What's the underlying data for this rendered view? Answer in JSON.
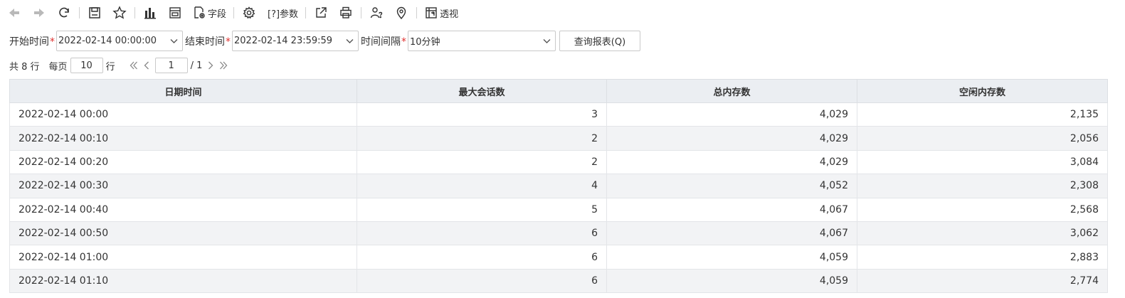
{
  "toolbar": {
    "field_label": "字段",
    "params_label": "[?]参数",
    "pivot_label": "透视"
  },
  "filters": {
    "start_label": "开始时间",
    "start_value": "2022-02-14 00:00:00",
    "end_label": "结束时间",
    "end_value": "2022-02-14 23:59:59",
    "interval_label": "时间间隔",
    "interval_value": "10分钟",
    "required_mark": "*",
    "query_button": "查询报表(Q)"
  },
  "pager": {
    "total_text": "共 8 行",
    "per_page_label": "每页",
    "per_page_value": "10",
    "row_unit": "行",
    "current_page": "1",
    "total_pages": "/ 1"
  },
  "table": {
    "columns": [
      "日期时间",
      "最大会话数",
      "总内存数",
      "空闲内存数"
    ],
    "rows": [
      [
        "2022-02-14  00:00",
        "3",
        "4,029",
        "2,135"
      ],
      [
        "2022-02-14  00:10",
        "2",
        "4,029",
        "2,056"
      ],
      [
        "2022-02-14  00:20",
        "2",
        "4,029",
        "3,084"
      ],
      [
        "2022-02-14  00:30",
        "4",
        "4,052",
        "2,308"
      ],
      [
        "2022-02-14  00:40",
        "5",
        "4,067",
        "2,568"
      ],
      [
        "2022-02-14  00:50",
        "6",
        "4,067",
        "3,062"
      ],
      [
        "2022-02-14  01:00",
        "6",
        "4,059",
        "2,883"
      ],
      [
        "2022-02-14  01:10",
        "6",
        "4,059",
        "2,774"
      ]
    ]
  },
  "colors": {
    "required": "#e0312f",
    "header_bg": "#ebeef2",
    "row_alt_bg": "#f2f3f5",
    "disabled_icon": "#b9b9b9"
  }
}
